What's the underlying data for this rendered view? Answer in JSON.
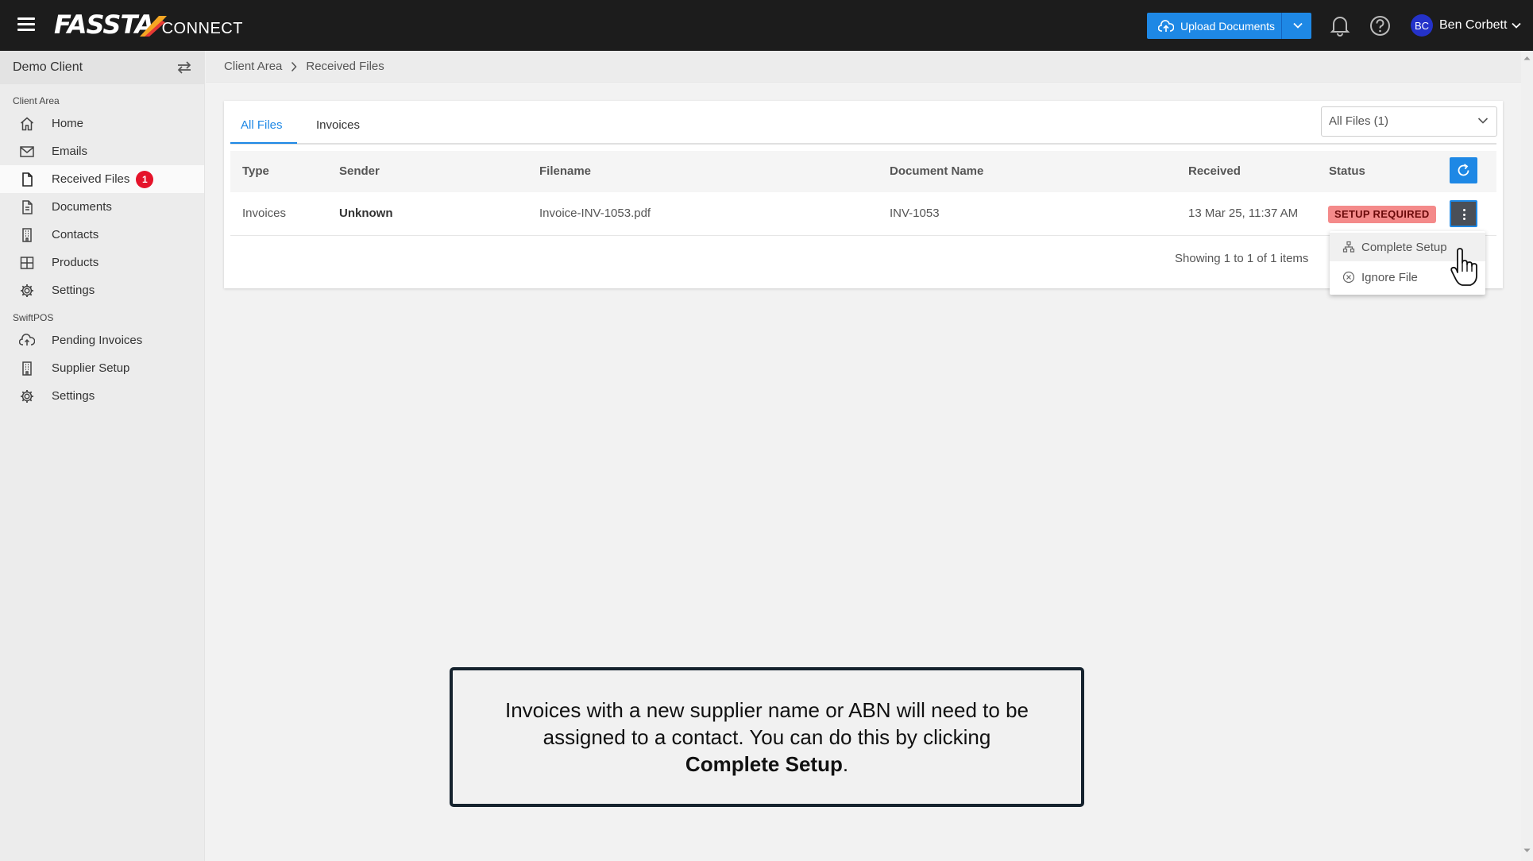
{
  "header": {
    "logo_main": "FASSTA",
    "logo_sub": "CONNECT",
    "upload_label": "Upload Documents",
    "user_initials": "BC",
    "user_name": "Ben Corbett",
    "icons": [
      "menu-icon",
      "upload-cloud-icon",
      "chevron-down-icon",
      "bell-icon",
      "help-icon"
    ]
  },
  "sidebar": {
    "client_name": "Demo Client",
    "section_client_area": "Client Area",
    "client_area_items": [
      {
        "label": "Home",
        "icon": "home-icon"
      },
      {
        "label": "Emails",
        "icon": "mail-icon"
      },
      {
        "label": "Received Files",
        "icon": "file-icon",
        "badge": "1",
        "active": true
      },
      {
        "label": "Documents",
        "icon": "document-icon"
      },
      {
        "label": "Contacts",
        "icon": "building-icon"
      },
      {
        "label": "Products",
        "icon": "grid-icon"
      },
      {
        "label": "Settings",
        "icon": "gear-icon"
      }
    ],
    "section_swiftpos": "SwiftPOS",
    "swiftpos_items": [
      {
        "label": "Pending Invoices",
        "icon": "cloud-upload-icon"
      },
      {
        "label": "Supplier Setup",
        "icon": "building-icon"
      },
      {
        "label": "Settings",
        "icon": "gear-icon"
      }
    ]
  },
  "breadcrumb": {
    "root": "Client Area",
    "current": "Received Files"
  },
  "main": {
    "tabs": [
      {
        "label": "All Files",
        "active": true
      },
      {
        "label": "Invoices",
        "active": false
      }
    ],
    "filter_value": "All Files (1)",
    "columns": [
      "Type",
      "Sender",
      "Filename",
      "Document Name",
      "Received",
      "Status"
    ],
    "rows": [
      {
        "type": "Invoices",
        "sender": "Unknown",
        "filename": "Invoice-INV-1053.pdf",
        "document_name": "INV-1053",
        "received": "13 Mar 25, 11:37 AM",
        "status": "SETUP REQUIRED"
      }
    ],
    "showing": "Showing 1 to 1 of 1 items"
  },
  "row_menu": {
    "complete_setup": "Complete Setup",
    "ignore_file": "Ignore File"
  },
  "callout": {
    "line1": "Invoices with a new supplier name or ABN will need to be",
    "line2": "assigned to a contact. You can do this by clicking",
    "emphasis": "Complete Setup",
    "end": "."
  },
  "colors": {
    "topbar": "#1c1c1c",
    "accent": "#1e88e5",
    "status_badge_bg": "#f48a8a",
    "notification_badge": "#e5132a",
    "avatar": "#2432c9"
  }
}
